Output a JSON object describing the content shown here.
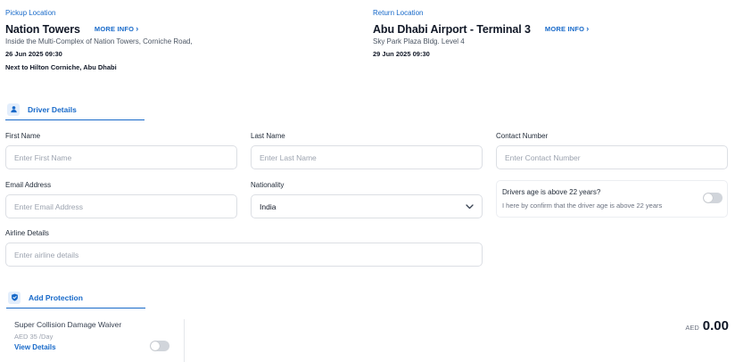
{
  "pickup": {
    "label": "Pickup Location",
    "title": "Nation Towers",
    "more_info": "MORE INFO",
    "address": "Inside the Multi-Complex of Nation Towers, Corniche Road,",
    "datetime": "26 Jun 2025 09:30",
    "note": "Next to Hilton Corniche, Abu Dhabi"
  },
  "return": {
    "label": "Return Location",
    "title": "Abu Dhabi Airport - Terminal 3",
    "more_info": "MORE INFO",
    "address": "Sky Park Plaza Bldg. Level 4",
    "datetime": "29 Jun 2025 09:30"
  },
  "driver_section": {
    "title": "Driver Details",
    "icon": "user-icon"
  },
  "form": {
    "first_name": {
      "label": "First Name",
      "placeholder": "Enter First Name",
      "value": ""
    },
    "last_name": {
      "label": "Last Name",
      "placeholder": "Enter Last Name",
      "value": ""
    },
    "contact": {
      "label": "Contact Number",
      "placeholder": "Enter Contact Number",
      "value": ""
    },
    "email": {
      "label": "Email Address",
      "placeholder": "Enter Email Address",
      "value": ""
    },
    "nationality": {
      "label": "Nationality",
      "value": "India"
    },
    "airline": {
      "label": "Airline Details",
      "placeholder": "Enter airline details",
      "value": ""
    }
  },
  "age_check": {
    "title": "Drivers age is above 22 years?",
    "description": "I here by confirm that the driver age is above 22 years",
    "checked": false
  },
  "protection_section": {
    "title": "Add Protection",
    "icon": "shield-check-icon"
  },
  "protection": {
    "name": "Super Collision Damage Waiver",
    "price": "AED 35 /Day",
    "link": "View Details",
    "enabled": false
  },
  "total": {
    "currency": "AED",
    "amount": "0.00"
  },
  "colors": {
    "accent": "#1769c9",
    "toggle_off": "#d1d5db"
  }
}
